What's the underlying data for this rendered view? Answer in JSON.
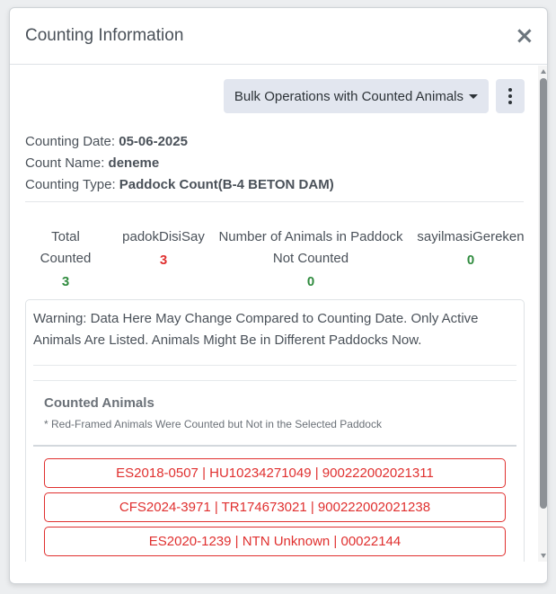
{
  "modal": {
    "title": "Counting Information",
    "close_label": "×"
  },
  "toolbar": {
    "bulk_label": "Bulk Operations with Counted Animals",
    "more_icon": "kebab-vertical-icon"
  },
  "info": {
    "date_label": "Counting Date: ",
    "date_value": "05-06-2025",
    "name_label": "Count Name: ",
    "name_value": "deneme",
    "type_label": "Counting Type: ",
    "type_value": "Paddock Count(B-4 BETON DAM)"
  },
  "stats": [
    {
      "label_line1": "Total",
      "label_line2": "Counted",
      "value": "3",
      "color": "#2f8b3e"
    },
    {
      "label_line1": "padokDisiSay",
      "label_line2": "",
      "value": "3",
      "color": "#e0302f"
    },
    {
      "label_line1": "Number of Animals in Paddock",
      "label_line2": "Not Counted",
      "value": "0",
      "color": "#2f8b3e"
    },
    {
      "label_line1": "sayilmasiGereken",
      "label_line2": "",
      "value": "0",
      "color": "#2f8b3e"
    }
  ],
  "card": {
    "warning": "Warning: Data Here May Change Compared to Counting Date. Only Active Animals Are Listed. Animals Might Be in Different Paddocks Now.",
    "counted_title": "Counted Animals",
    "counted_note": "* Red-Framed Animals Were Counted but Not in the Selected Paddock",
    "animals": [
      "ES2018-0507 | HU10234271049 | 900222002021311",
      "CFS2024-3971 | TR174673021 | 900222002021238",
      "ES2020-1239 | NTN Unknown | 00022144"
    ]
  },
  "colors": {
    "accent_red": "#e0302f",
    "accent_green": "#2f8b3e",
    "button_bg": "#e2e6ef"
  }
}
